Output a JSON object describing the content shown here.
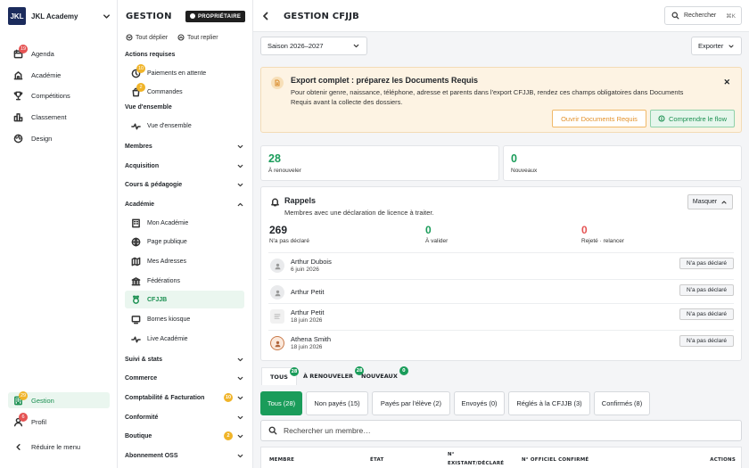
{
  "brand": {
    "logo": "JKL",
    "name": "JKL Academy"
  },
  "nav": [
    {
      "label": "Agenda",
      "icon": "calendar-icon",
      "badge": "19"
    },
    {
      "label": "Académie",
      "icon": "academy-icon"
    },
    {
      "label": "Compétitions",
      "icon": "trophy-icon"
    },
    {
      "label": "Classement",
      "icon": "ranking-icon"
    },
    {
      "label": "Design",
      "icon": "palette-icon"
    }
  ],
  "nav_bottom": [
    {
      "label": "Gestion",
      "icon": "building-icon",
      "badge": "29"
    },
    {
      "label": "Profil",
      "icon": "user-icon",
      "badge": "6"
    },
    {
      "label": "Réduire le menu",
      "icon": "collapse-icon"
    }
  ],
  "panel": {
    "title": "GESTION",
    "owner": "PROPRIÉTAIRE",
    "expand_all": "Tout déplier",
    "collapse_all": "Tout replier",
    "actions_head": "Actions requises",
    "payments": "Paiements en attente",
    "payments_badge": "10",
    "orders": "Commandes",
    "orders_badge": "2",
    "overview_head": "Vue d'ensemble",
    "overview": "Vue d'ensemble",
    "g_members": "Membres",
    "g_acq": "Acquisition",
    "g_courses": "Cours & pédagogie",
    "g_academy": "Académie",
    "academy_items": [
      "Mon Académie",
      "Page publique",
      "Mes Adresses",
      "Fédérations",
      "CFJJB",
      "Bornes kiosque",
      "Live Académie"
    ],
    "g_follow": "Suivi & stats",
    "g_commerce": "Commerce",
    "g_compta": "Comptabilité & Facturation",
    "compta_badge": "10",
    "g_conf": "Conformité",
    "g_shop": "Boutique",
    "shop_badge": "2",
    "g_oss": "Abonnement OSS"
  },
  "header": {
    "title": "GESTION CFJJB",
    "search": "Rechercher",
    "kbd": "⌘K"
  },
  "season": "Saison 2026–2027",
  "export": "Exporter",
  "banner": {
    "title": "Export complet : préparez les Documents Requis",
    "text": "Pour obtenir genre, naissance, téléphone, adresse et parents dans l'export CFJJB, rendez ces champs obligatoires dans Documents Requis avant la collecte des dossiers.",
    "btn_open": "Ouvrir Documents Requis",
    "btn_flow": "Comprendre le flow"
  },
  "stats": {
    "renew_num": "28",
    "renew_lbl": "À renouveler",
    "new_num": "0",
    "new_lbl": "Nouveaux"
  },
  "reminders": {
    "title": "Rappels",
    "subtitle": "Membres avec une déclaration de licence à traiter.",
    "hide": "Masquer",
    "s1_num": "269",
    "s1_lbl": "N'a pas déclaré",
    "s2_num": "0",
    "s2_lbl": "À valider",
    "s3_num": "0",
    "s3_lbl": "Rejeté · relancer",
    "rows": [
      {
        "name": "Arthur Dubois",
        "date": "6 juin 2026",
        "status": "N'a pas déclaré"
      },
      {
        "name": "Arthur Petit",
        "date": "",
        "status": "N'a pas déclaré"
      },
      {
        "name": "Arthur Petit",
        "date": "18 juin 2026",
        "status": "N'a pas déclaré"
      },
      {
        "name": "Athena Smith",
        "date": "18 juin 2026",
        "status": "N'a pas déclaré"
      }
    ]
  },
  "tabs": [
    {
      "label": "TOUS",
      "count": "28"
    },
    {
      "label": "À RENOUVELER",
      "count": "28"
    },
    {
      "label": "NOUVEAUX",
      "count": "0"
    }
  ],
  "filters": [
    "Tous (28)",
    "Non payés (15)",
    "Payés par l'élève (2)",
    "Envoyés (0)",
    "Réglés à la CFJJB (3)",
    "Confirmés (8)"
  ],
  "member_search": "Rechercher un membre…",
  "table": {
    "h1": "MEMBRE",
    "h2": "ÉTAT",
    "h3a": "N°",
    "h3b": "EXISTANT/DÉCLARÉ",
    "h4": "N° OFFICIEL CONFIRMÉ",
    "h5": "ACTIONS"
  },
  "colors": {
    "accent": "#1a9c5a",
    "brand": "#1b2b5c",
    "warning": "#f0b429",
    "danger": "#e55353"
  }
}
